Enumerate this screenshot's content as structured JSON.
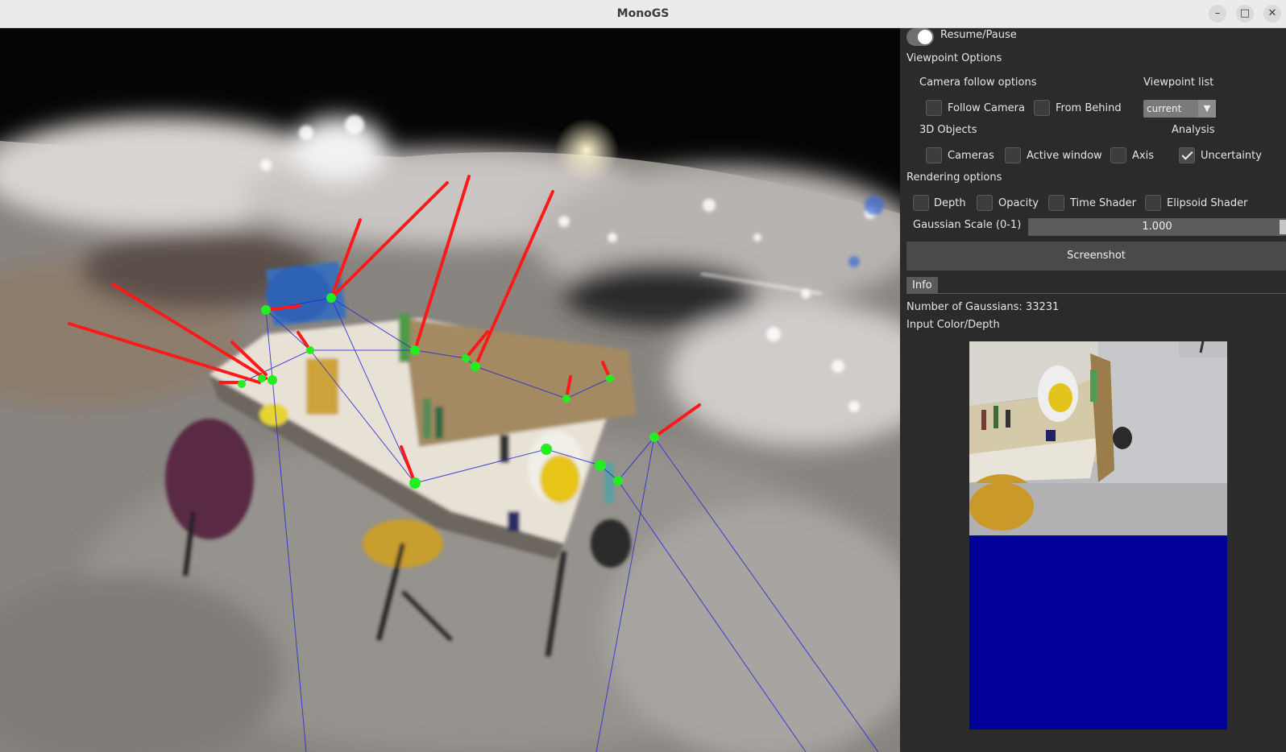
{
  "window": {
    "title": "MonoGS"
  },
  "window_controls": {
    "minimize": "–",
    "maximize": "□",
    "close": "✕"
  },
  "panel": {
    "resume_pause": {
      "label": "Resume/Pause",
      "enabled": true
    },
    "viewpoint_options": {
      "heading": "Viewpoint Options",
      "camera_follow_heading": "Camera follow options",
      "follow_camera": {
        "label": "Follow Camera",
        "checked": false
      },
      "from_behind": {
        "label": "From Behind",
        "checked": false
      },
      "viewpoint_list_heading": "Viewpoint list",
      "viewpoint_list_value": "current",
      "objects_heading": "3D Objects",
      "analysis_heading": "Analysis",
      "cameras": {
        "label": "Cameras",
        "checked": false
      },
      "active_window": {
        "label": "Active window",
        "checked": false
      },
      "axis": {
        "label": "Axis",
        "checked": false
      },
      "uncertainty": {
        "label": "Uncertainty",
        "checked": true
      }
    },
    "rendering_options": {
      "heading": "Rendering options",
      "depth": {
        "label": "Depth",
        "checked": false
      },
      "opacity": {
        "label": "Opacity",
        "checked": false
      },
      "time_shader": {
        "label": "Time Shader",
        "checked": false
      },
      "elipsoid_shader": {
        "label": "Elipsoid Shader",
        "checked": false
      },
      "gaussian_scale_label": "Gaussian Scale (0-1)",
      "gaussian_scale_value": "1.000"
    },
    "screenshot_label": "Screenshot",
    "info": {
      "tab_label": "Info",
      "num_gaussians": "Number of Gaussians: 33231",
      "input_label": "Input Color/Depth"
    }
  },
  "colors": {
    "background": "#2b2b2b",
    "depth_preview": "#000099",
    "trajectory_line": "#2b2bd6",
    "uncertainty_ray": "#ff1a1a",
    "camera_node": "#22ee22"
  },
  "icons": {
    "dropdown": "chevron-down-icon",
    "check": "checkmark-icon"
  }
}
